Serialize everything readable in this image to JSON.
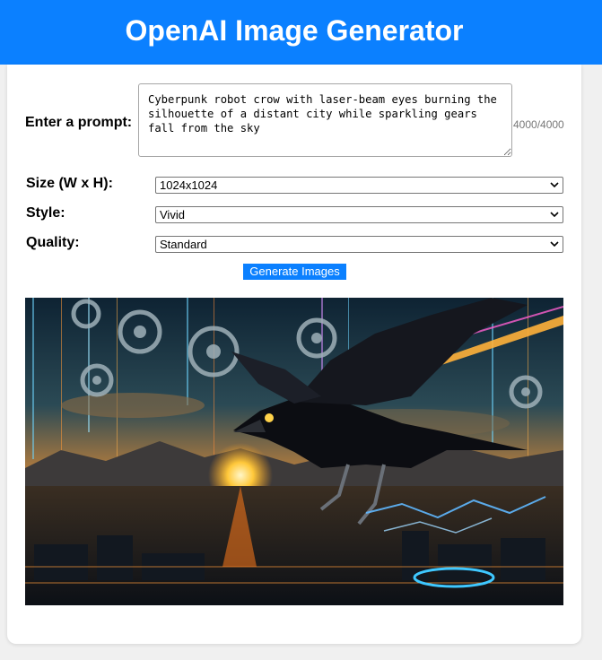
{
  "header": {
    "title": "OpenAI Image Generator"
  },
  "form": {
    "prompt_label": "Enter a prompt:",
    "prompt_value": "Cyberpunk robot crow with laser-beam eyes burning the silhouette of a distant city while sparkling gears fall from the sky",
    "char_count": "4000/4000",
    "size_label": "Size (W x H):",
    "size_value": "1024x1024",
    "style_label": "Style:",
    "style_value": "Vivid",
    "quality_label": "Quality:",
    "quality_value": "Standard",
    "generate_label": "Generate Images"
  },
  "colors": {
    "brand": "#0b80ff",
    "header_text": "#ffffff"
  },
  "result": {
    "image_subject": "cyberpunk-robot-crow-image"
  }
}
